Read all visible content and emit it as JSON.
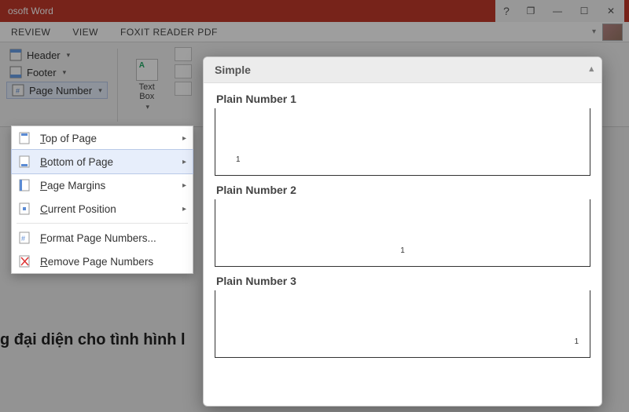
{
  "titlebar": {
    "app_title": "osoft Word",
    "help_label": "?",
    "restore_label": "❐",
    "minimize_label": "—",
    "maximize_label": "☐",
    "close_label": "✕"
  },
  "ribbon": {
    "tabs": [
      "REVIEW",
      "VIEW",
      "FOXIT READER PDF"
    ],
    "username": "",
    "header_footer": {
      "header_label": "Header",
      "footer_label": "Footer",
      "page_number_label": "Page Number"
    },
    "text_box_label": "Text\nBox"
  },
  "page_number_menu": {
    "items": [
      {
        "label": "Top of Page",
        "accel": "T",
        "has_sub": true
      },
      {
        "label": "Bottom of Page",
        "accel": "B",
        "has_sub": true,
        "hover": true
      },
      {
        "label": "Page Margins",
        "accel": "P",
        "has_sub": true
      },
      {
        "label": "Current Position",
        "accel": "C",
        "has_sub": true
      },
      {
        "label": "Format Page Numbers...",
        "accel": "F",
        "has_sub": false
      },
      {
        "label": "Remove Page Numbers",
        "accel": "R",
        "has_sub": false
      }
    ]
  },
  "gallery": {
    "section_title": "Simple",
    "items": [
      {
        "title": "Plain Number 1",
        "sample": "1",
        "align": "left"
      },
      {
        "title": "Plain Number 2",
        "sample": "1",
        "align": "center"
      },
      {
        "title": "Plain Number 3",
        "sample": "1",
        "align": "right"
      }
    ]
  },
  "document": {
    "visible_line_1": "g đại diện cho tình hình l",
    "visible_line_2": ""
  },
  "colors": {
    "title_bg": "#c0392b",
    "highlight_bg": "#e7eefb",
    "highlight_border": "#b9c9e8"
  }
}
